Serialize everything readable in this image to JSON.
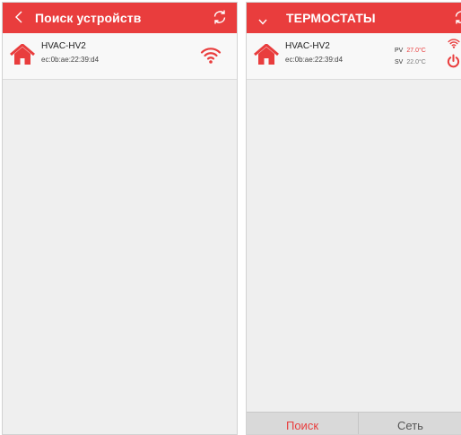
{
  "search_screen": {
    "title": "Поиск устройств",
    "device": {
      "name": "HVAC-HV2",
      "mac": "ec:0b:ae:22:39:d4"
    }
  },
  "thermostats_screen": {
    "title": "ТЕРМОСТАТЫ",
    "device": {
      "name": "HVAC-HV2",
      "mac": "ec:0b:ae:22:39:d4",
      "pv_label": "PV",
      "pv_value": "27.0°C",
      "sv_label": "SV",
      "sv_value": "22.0°C"
    },
    "tabs": {
      "search": "Поиск",
      "network": "Сеть"
    }
  },
  "colors": {
    "accent": "#e93d3d",
    "content_background": "#efefef",
    "bottom_bar": "#d9d9d9"
  },
  "icons": [
    "back-chevron-icon",
    "refresh-icon",
    "home-icon",
    "wifi-icon",
    "dropdown-chevron-icon",
    "power-icon"
  ]
}
